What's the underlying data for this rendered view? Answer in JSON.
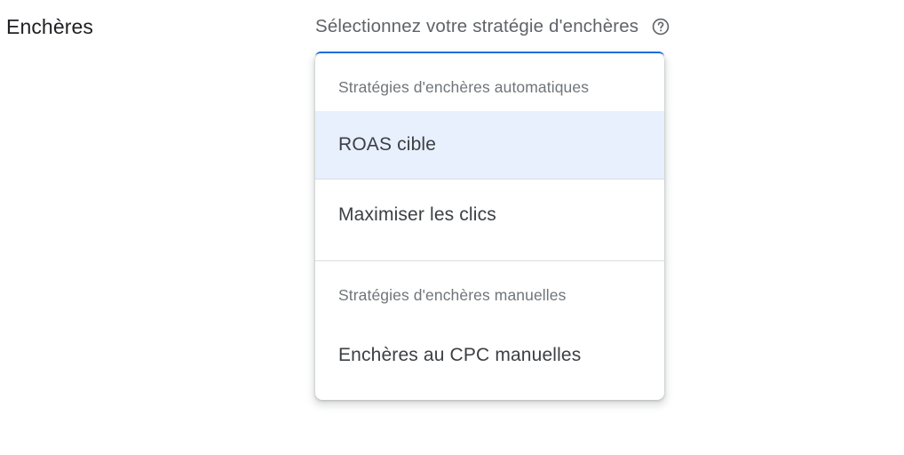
{
  "section": {
    "title": "Enchères"
  },
  "field": {
    "label": "Sélectionnez votre stratégie d'enchères",
    "help_icon": "help-circle-icon"
  },
  "dropdown": {
    "groups": [
      {
        "header": "Stratégies d'enchères automatiques",
        "options": [
          {
            "label": "ROAS cible",
            "highlighted": true
          },
          {
            "label": "Maximiser les clics",
            "highlighted": false
          }
        ]
      },
      {
        "header": "Stratégies d'enchères manuelles",
        "options": [
          {
            "label": "Enchères au CPC manuelles",
            "highlighted": false
          }
        ]
      }
    ]
  },
  "colors": {
    "accent": "#1a73e8",
    "highlight_bg": "#e8f0fe",
    "text_primary": "#202124",
    "text_secondary": "#5f6368"
  }
}
